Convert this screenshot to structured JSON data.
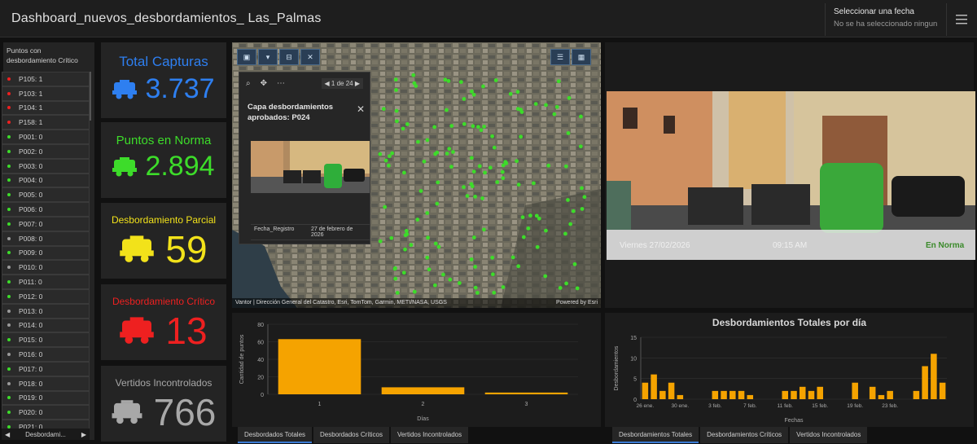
{
  "header": {
    "title": "Dashboard_nuevos_desbordamientos_ Las_Palmas",
    "date_filter_label": "Seleccionar una fecha",
    "date_filter_value": "No se ha seleccionado ningun..."
  },
  "list": {
    "title": "Puntos con desbordamiento Crítico",
    "items": [
      {
        "label": "P105: 1",
        "status": "critico"
      },
      {
        "label": "P103: 1",
        "status": "critico"
      },
      {
        "label": "P104: 1",
        "status": "critico"
      },
      {
        "label": "P158: 1",
        "status": "critico"
      },
      {
        "label": "P001: 0",
        "status": "norma"
      },
      {
        "label": "P002: 0",
        "status": "norma"
      },
      {
        "label": "P003: 0",
        "status": "norma"
      },
      {
        "label": "P004: 0",
        "status": "norma"
      },
      {
        "label": "P005: 0",
        "status": "norma"
      },
      {
        "label": "P006: 0",
        "status": "norma"
      },
      {
        "label": "P007: 0",
        "status": "norma"
      },
      {
        "label": "P008: 0",
        "status": "gris"
      },
      {
        "label": "P009: 0",
        "status": "norma"
      },
      {
        "label": "P010: 0",
        "status": "gris"
      },
      {
        "label": "P011: 0",
        "status": "norma"
      },
      {
        "label": "P012: 0",
        "status": "norma"
      },
      {
        "label": "P013: 0",
        "status": "gris"
      },
      {
        "label": "P014: 0",
        "status": "gris"
      },
      {
        "label": "P015: 0",
        "status": "norma"
      },
      {
        "label": "P016: 0",
        "status": "gris"
      },
      {
        "label": "P017: 0",
        "status": "norma"
      },
      {
        "label": "P018: 0",
        "status": "gris"
      },
      {
        "label": "P019: 0",
        "status": "norma"
      },
      {
        "label": "P020: 0",
        "status": "norma"
      },
      {
        "label": "P021: 0",
        "status": "norma"
      }
    ],
    "tab_label": "Desbordami..."
  },
  "kpis": {
    "total": {
      "title": "Total Capturas",
      "value": "3.737",
      "color": "#2e7ff0"
    },
    "norma": {
      "title": "Puntos en Norma",
      "value": "2.894",
      "color": "#3ddc2a"
    },
    "parcial": {
      "title": "Desbordamiento Parcial",
      "value": "59",
      "color": "#f2e21a"
    },
    "critico": {
      "title": "Desbordamiento Crítico",
      "value": "13",
      "color": "#ee2020"
    },
    "vertidos": {
      "title": "Vertidos Incontrolados",
      "value": "766",
      "color": "#a8a8a8"
    }
  },
  "map": {
    "popup": {
      "pager": "1 de 24",
      "title": "Capa desbordamientos aprobados: P024",
      "field_name": "Fecha_Registro",
      "field_value": "27 de febrero de 2026"
    },
    "credit_left": "Vantor | Dirección General del Catastro, Esri, TomTom, Garmin, METI/NASA, USGS",
    "credit_right": "Powered by Esri"
  },
  "photo": {
    "date_text": "Viernes 27/02/2026",
    "time_text": "09:15 AM",
    "status_text": "En Norma"
  },
  "chart_left_tabs": [
    "Desbordados Totales",
    "Desbordados Críticos",
    "Vertidos Incontrolados"
  ],
  "chart_right_tabs": [
    "Desbordamientos Totales",
    "Desbordamientos Críticos",
    "Vertidos Incontrolados"
  ],
  "colors": {
    "bar": "#f5a300",
    "critico": "#ee2020",
    "norma": "#3ddc2a",
    "gris": "#9a9a9a"
  },
  "chart_data": [
    {
      "type": "bar",
      "title": "",
      "xlabel": "Días",
      "ylabel": "Cantidad de puntos",
      "categories": [
        "1",
        "2",
        "3"
      ],
      "values": [
        63,
        8,
        2
      ],
      "ylim": [
        0,
        80
      ],
      "yticks": [
        0,
        20,
        40,
        60,
        80
      ]
    },
    {
      "type": "bar",
      "title": "Desbordamientos Totales por día",
      "xlabel": "Fechas",
      "ylabel": "Desbordamientos",
      "ylim": [
        0,
        15
      ],
      "yticks": [
        0,
        5,
        10,
        15
      ],
      "x_tick_labels": [
        "26 ene.",
        "30 ene.",
        "3 feb.",
        "7 feb.",
        "11 feb.",
        "15 feb.",
        "19 feb.",
        "23 feb."
      ],
      "values": [
        4,
        6,
        2,
        4,
        1,
        0,
        0,
        0,
        2,
        2,
        2,
        2,
        1,
        0,
        0,
        0,
        2,
        2,
        3,
        2,
        3,
        0,
        0,
        0,
        4,
        0,
        3,
        1,
        2,
        0,
        0,
        2,
        8,
        11,
        4
      ]
    }
  ]
}
